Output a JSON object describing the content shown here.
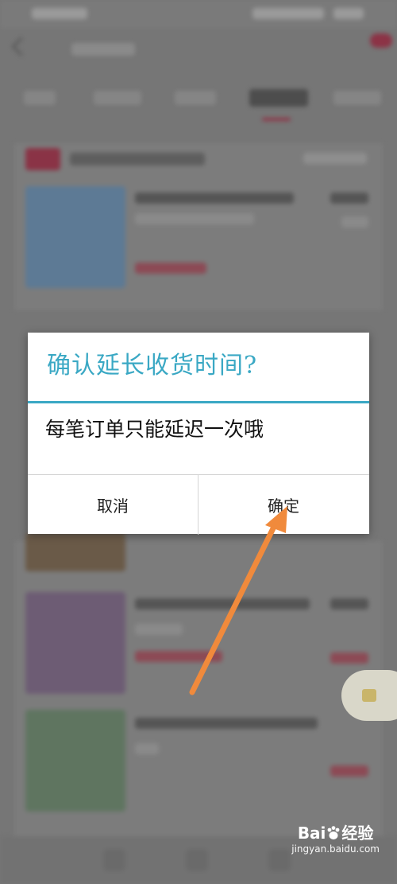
{
  "dialog": {
    "title": "确认延长收货时间?",
    "message": "每笔订单只能延迟一次哦",
    "cancel_label": "取消",
    "confirm_label": "确定"
  },
  "watermark": {
    "brand_text": "Bai",
    "brand_suffix": "经验",
    "domain": "jingyan.baidu.com"
  },
  "colors": {
    "accent": "#3aa8c4",
    "arrow": "#f08a3c",
    "overlay": "#767676"
  },
  "icons": {
    "back": "back-arrow-icon",
    "watermark_logo": "baidu-paw-icon"
  }
}
